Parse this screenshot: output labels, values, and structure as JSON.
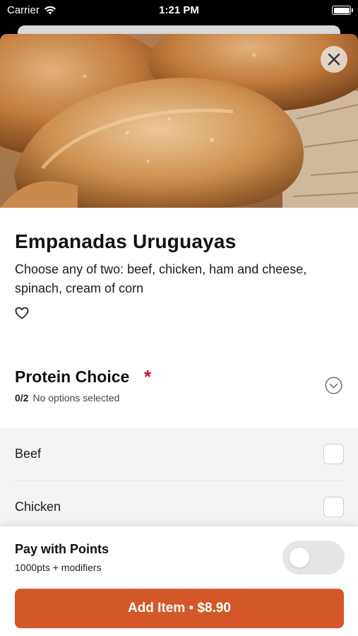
{
  "status_bar": {
    "carrier": "Carrier",
    "time": "1:21 PM"
  },
  "item": {
    "title": "Empanadas Uruguayas",
    "description": "Choose any of two: beef, chicken, ham and cheese, spinach, cream of corn"
  },
  "protein_choice": {
    "title": "Protein Choice",
    "required_marker": "*",
    "count": "0/2",
    "status": "No options selected",
    "options": [
      {
        "label": "Beef",
        "checked": false
      },
      {
        "label": "Chicken",
        "checked": false
      }
    ]
  },
  "points": {
    "title": "Pay with Points",
    "subtitle": "1000pts + modifiers",
    "enabled": false
  },
  "add_button": {
    "label": "Add Item • $8.90"
  },
  "colors": {
    "accent": "#d4572a",
    "required": "#c8102e"
  },
  "icons": [
    "wifi-icon",
    "battery-icon",
    "close-icon",
    "heart-icon",
    "chevron-down-icon"
  ]
}
